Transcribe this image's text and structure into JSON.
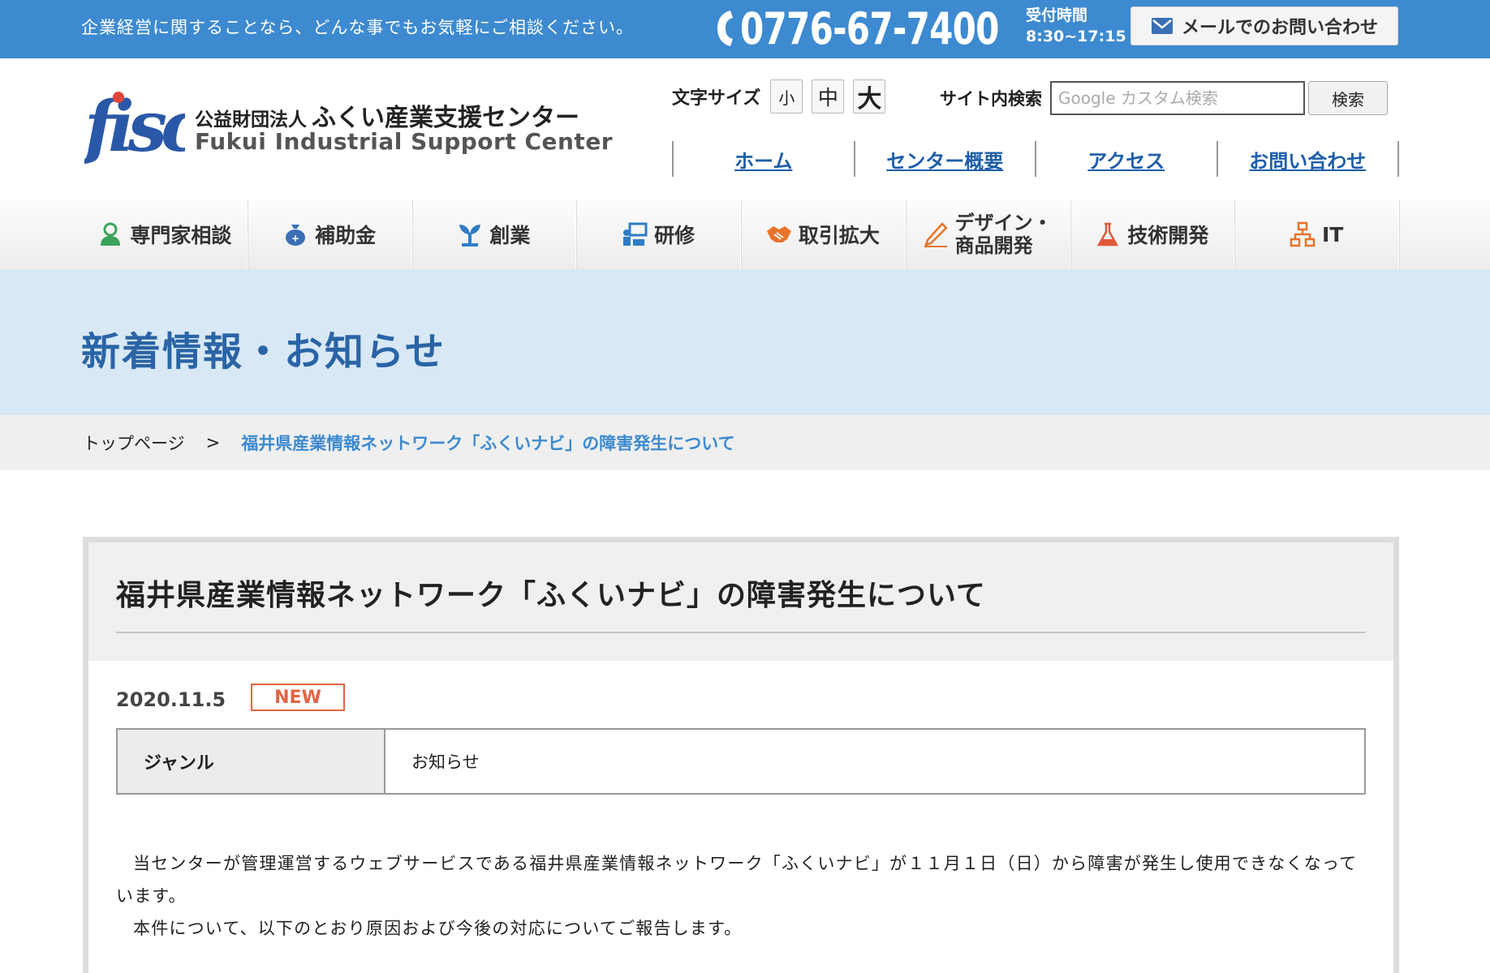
{
  "topbar": {
    "tagline": "企業経営に関することなら、どんな事でもお気軽にご相談ください。",
    "phone": "0776-67-7400",
    "hours_label": "受付時間",
    "hours_value": "8:30~17:15",
    "mail_button": "メールでのお問い合わせ"
  },
  "logo": {
    "mark": "fisc",
    "org_prefix": "公益財団法人",
    "org_name": "ふくい産業支援センター",
    "org_en": "Fukui Industrial Support Center"
  },
  "font_size": {
    "label": "文字サイズ",
    "small": "小",
    "medium": "中",
    "large": "大"
  },
  "search": {
    "label": "サイト内検索",
    "placeholder": "Google カスタム検索",
    "button": "検索"
  },
  "subnav": [
    {
      "label": "ホーム"
    },
    {
      "label": "センター概要"
    },
    {
      "label": "アクセス"
    },
    {
      "label": "お問い合わせ"
    }
  ],
  "categories": [
    {
      "label": "専門家相談",
      "icon": "person-icon",
      "color": "#3aa35b"
    },
    {
      "label": "補助金",
      "icon": "money-bag-icon",
      "color": "#3a6fb5"
    },
    {
      "label": "創業",
      "icon": "sprout-icon",
      "color": "#2f7cc4"
    },
    {
      "label": "研修",
      "icon": "training-icon",
      "color": "#2f7cc4"
    },
    {
      "label": "取引拡大",
      "icon": "handshake-icon",
      "color": "#e8732a"
    },
    {
      "label_line1": "デザイン・",
      "label_line2": "商品開発",
      "icon": "pencil-icon",
      "color": "#e8732a"
    },
    {
      "label": "技術開発",
      "icon": "flask-icon",
      "color": "#e05a3a"
    },
    {
      "label": "IT",
      "icon": "network-icon",
      "color": "#e8732a"
    }
  ],
  "page_title": "新着情報・お知らせ",
  "breadcrumb": {
    "home": "トップページ",
    "separator": ">",
    "current": "福井県産業情報ネットワーク「ふくいナビ」の障害発生について"
  },
  "article": {
    "title": "福井県産業情報ネットワーク「ふくいナビ」の障害発生について",
    "date": "2020.11.5",
    "badge": "NEW",
    "genre_label": "ジャンル",
    "genre_value": "お知らせ",
    "paragraph1": "当センターが管理運営するウェブサービスである福井県産業情報ネットワーク「ふくいナビ」が１１月１日（日）から障害が発生し使用できなくなっています。",
    "paragraph2": "本件について、以下のとおり原因および今後の対応についてご報告します。"
  },
  "colors": {
    "topbar": "#3d8ad0",
    "link": "#1e5ea8",
    "title_band": "#d8e8f5",
    "badge": "#e26345"
  }
}
